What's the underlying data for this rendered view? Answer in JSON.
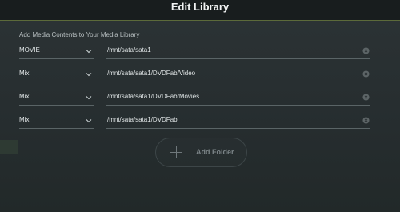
{
  "dialog": {
    "title": "Edit Library",
    "subtitle": "Add Media Contents to Your Media Library"
  },
  "rows": [
    {
      "type": "MOVIE",
      "path": "/mnt/sata/sata1"
    },
    {
      "type": "Mix",
      "path": "/mnt/sata/sata1/DVDFab/Video"
    },
    {
      "type": "Mix",
      "path": "/mnt/sata/sata1/DVDFab/Movies"
    },
    {
      "type": "Mix",
      "path": "/mnt/sata/sata1/DVDFab"
    }
  ],
  "add_folder": {
    "label": "Add Folder",
    "icon": "plus-icon"
  },
  "icons": {
    "chevron": "chevron-down-icon",
    "clear": "clear-icon"
  },
  "colors": {
    "background": "#232a2c",
    "titlebar": "#181d1e",
    "accent_line": "#5c6a3a",
    "text": "#dfe4e5",
    "muted_text": "#7b8487"
  }
}
